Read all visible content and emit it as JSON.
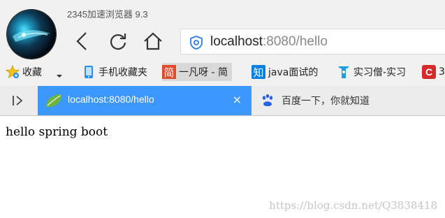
{
  "app": {
    "title": "2345加速浏览器 9.3"
  },
  "address_bar": {
    "host": "localhost",
    "rest": ":8080/hello",
    "shield_icon": "security-shield-icon"
  },
  "bookmarks": {
    "favorites_label": "收藏",
    "mobile_label": "手机收藏夹",
    "jian_badge": "简",
    "jian_label": "一凡呀 - 简",
    "zhi_badge": "知",
    "zhi_label": "java面试的",
    "intern_label": "实习僧-实习",
    "extra_badge": "C",
    "extra_label": "3"
  },
  "tabs": [
    {
      "title": "localhost:8080/hello",
      "active": true,
      "close": "×"
    },
    {
      "title": "百度一下，你就知道",
      "active": false
    }
  ],
  "page": {
    "text": "hello spring boot",
    "watermark": "https://blog.csdn.net/Q3838418"
  },
  "colors": {
    "chrome_bg": "#f1f1f1",
    "active_tab": "#3c97ff",
    "jian_badge": "#e24a2f",
    "zhi_badge": "#0b7fdc",
    "extra_badge": "#d52a2a"
  }
}
